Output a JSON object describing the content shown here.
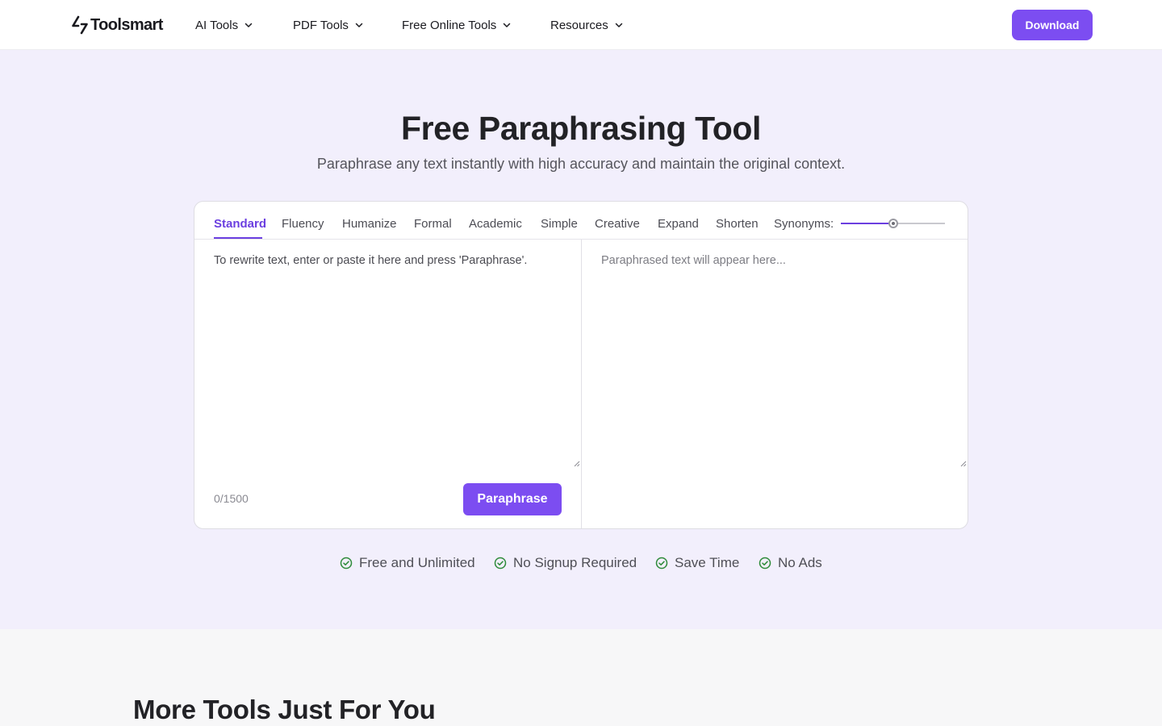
{
  "brand": {
    "name": "Toolsmart"
  },
  "nav": {
    "items": [
      {
        "label": "AI Tools"
      },
      {
        "label": "PDF Tools"
      },
      {
        "label": "Free Online Tools"
      },
      {
        "label": "Resources"
      }
    ],
    "download_label": "Download"
  },
  "hero": {
    "title": "Free Paraphrasing Tool",
    "subtitle": "Paraphrase any text instantly with high accuracy and maintain the original context."
  },
  "tool": {
    "modes": [
      "Standard",
      "Fluency",
      "Humanize",
      "Formal",
      "Academic",
      "Simple",
      "Creative",
      "Expand",
      "Shorten"
    ],
    "active_mode": "Standard",
    "synonyms_label": "Synonyms:",
    "synonyms_level": 0.5,
    "input_placeholder": "To rewrite text, enter or paste it here and press 'Paraphrase'.",
    "output_placeholder": "Paraphrased text will appear here...",
    "char_counter": "0/1500",
    "paraphrase_label": "Paraphrase"
  },
  "features": [
    "Free and Unlimited",
    "No Signup Required",
    "Save Time",
    "No Ads"
  ],
  "more_tools": {
    "title": "More Tools Just For You"
  },
  "colors": {
    "accent": "#7c4df1",
    "accent_text": "#6b3fe0",
    "hero_bg": "#f2effc",
    "check": "#2e8b3a"
  }
}
